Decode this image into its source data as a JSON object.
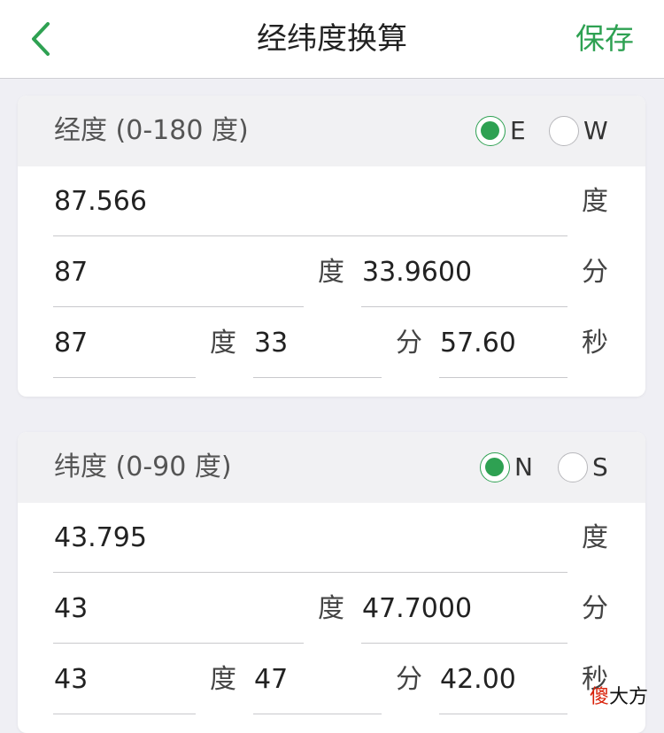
{
  "nav": {
    "title": "经纬度换算",
    "save_label": "保存"
  },
  "colors": {
    "accent": "#2ea152",
    "background": "#efeff4",
    "header_band": "#f1f1f3"
  },
  "longitude": {
    "title": "经度 (0-180 度)",
    "options": [
      {
        "label": "E",
        "selected": true
      },
      {
        "label": "W",
        "selected": false
      }
    ],
    "decimal": {
      "value": "87.566",
      "unit": "度"
    },
    "deg_min": {
      "degrees": "87",
      "degree_unit": "度",
      "minutes": "33.9600",
      "minute_unit": "分"
    },
    "dms": {
      "degrees": "87",
      "degree_unit": "度",
      "minutes": "33",
      "minute_unit": "分",
      "seconds": "57.60",
      "second_unit": "秒"
    }
  },
  "latitude": {
    "title": "纬度 (0-90 度)",
    "options": [
      {
        "label": "N",
        "selected": true
      },
      {
        "label": "S",
        "selected": false
      }
    ],
    "decimal": {
      "value": "43.795",
      "unit": "度"
    },
    "deg_min": {
      "degrees": "43",
      "degree_unit": "度",
      "minutes": "47.7000",
      "minute_unit": "分"
    },
    "dms": {
      "degrees": "43",
      "degree_unit": "度",
      "minutes": "47",
      "minute_unit": "分",
      "seconds": "42.00",
      "second_unit": "秒"
    }
  },
  "watermark": {
    "first": "傻",
    "rest": "大方"
  }
}
